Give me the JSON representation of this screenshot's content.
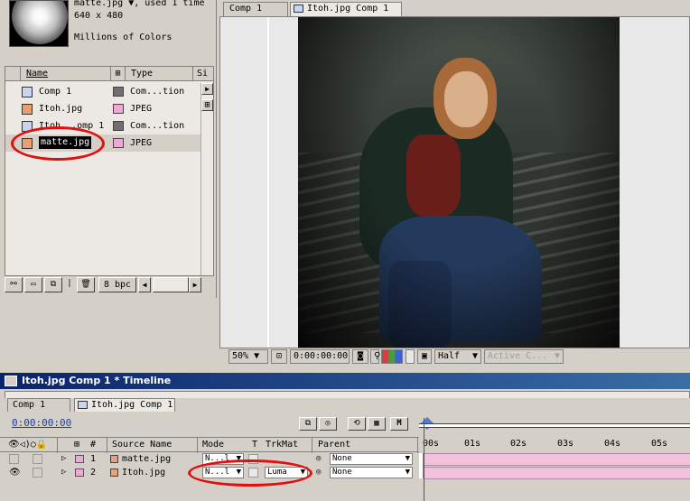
{
  "project": {
    "info_lines": [
      "matte.jpg ▼, used 1 time",
      "640 x 480",
      "",
      "Millions of Colors"
    ],
    "columns": {
      "name": "Name",
      "type": "Type",
      "size": "Si"
    },
    "items": [
      {
        "name": "Comp 1",
        "type": "Com...tion",
        "kind": "comp",
        "swatch": "#707070"
      },
      {
        "name": "Itoh.jpg",
        "type": "JPEG",
        "kind": "footage",
        "swatch": "#f0a8d8"
      },
      {
        "name": "Itoh...omp 1",
        "type": "Com...tion",
        "kind": "comp",
        "swatch": "#707070"
      },
      {
        "name": "matte.jpg",
        "type": "JPEG",
        "kind": "footage",
        "swatch": "#f0a8d8",
        "selected": true
      }
    ],
    "bit_depth": "8 bpc"
  },
  "comp": {
    "tabs": [
      "Comp 1",
      "Itoh.jpg Comp 1"
    ],
    "active_tab": 1,
    "zoom": "50%",
    "timecode": "0:00:00:00",
    "resolution": "Half",
    "view": "Active C..."
  },
  "timeline": {
    "title": "Itoh.jpg Comp 1 * Timeline",
    "tabs": [
      "Comp 1",
      "Itoh.jpg Comp 1"
    ],
    "timecode": "0:00:00:00",
    "columns": {
      "source_name": "Source Name",
      "mode": "Mode",
      "t": "T",
      "trkmat": "TrkMat",
      "parent": "Parent"
    },
    "layers": [
      {
        "num": "1",
        "source": "matte.jpg",
        "mode": "N...l",
        "trkmat": "",
        "parent": "None",
        "color": "#f0a8d8",
        "visible": false
      },
      {
        "num": "2",
        "source": "Itoh.jpg",
        "mode": "N...l",
        "trkmat": "Luma",
        "parent": "None",
        "color": "#f0a8d8",
        "visible": true
      }
    ],
    "ruler_ticks": [
      "00s",
      "01s",
      "02s",
      "03s",
      "04s",
      "05s"
    ],
    "m_button": "M"
  },
  "colors": {
    "title_bar": "#0a246a",
    "annotation": "#e01010",
    "layer_bar": "#f2c2dc",
    "timecode": "#1b3fa8"
  }
}
